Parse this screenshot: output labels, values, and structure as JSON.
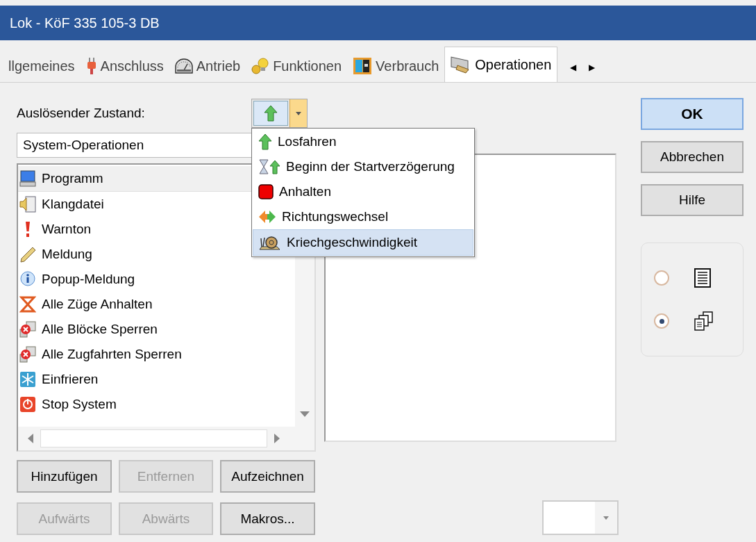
{
  "window": {
    "title": "Lok - KöF 335 105-3 DB"
  },
  "tabs": [
    {
      "label": "llgemeines",
      "selected": false
    },
    {
      "label": "Anschluss",
      "selected": false
    },
    {
      "label": "Antrieb",
      "selected": false
    },
    {
      "label": "Funktionen",
      "selected": false
    },
    {
      "label": "Verbrauch",
      "selected": false
    },
    {
      "label": "Operationen",
      "selected": true
    }
  ],
  "tab_scroll": [
    "◀",
    "▶"
  ],
  "trigger": {
    "label": "Auslösender Zustand:"
  },
  "trigger_menu": {
    "items": [
      {
        "label": "Losfahren",
        "selected": false
      },
      {
        "label": "Beginn der Startverzögerung",
        "selected": false
      },
      {
        "label": "Anhalten",
        "selected": false
      },
      {
        "label": "Richtungswechsel",
        "selected": false
      },
      {
        "label": "Kriechgeschwindigkeit",
        "selected": true
      }
    ]
  },
  "category": {
    "value": "System-Operationen"
  },
  "operations": {
    "items": [
      {
        "label": "Programm",
        "selected": true
      },
      {
        "label": "Klangdatei",
        "selected": false
      },
      {
        "label": "Warnton",
        "selected": false
      },
      {
        "label": "Meldung",
        "selected": false
      },
      {
        "label": "Popup-Meldung",
        "selected": false
      },
      {
        "label": "Alle Züge Anhalten",
        "selected": false
      },
      {
        "label": "Alle Blöcke Sperren",
        "selected": false
      },
      {
        "label": "Alle Zugfahrten Sperren",
        "selected": false
      },
      {
        "label": "Einfrieren",
        "selected": false
      },
      {
        "label": "Stop System",
        "selected": false
      }
    ]
  },
  "buttons": [
    {
      "label": "Hinzufügen",
      "disabled": false
    },
    {
      "label": "Entfernen",
      "disabled": true
    },
    {
      "label": "Aufzeichnen",
      "disabled": false
    },
    {
      "label": "Aufwärts",
      "disabled": true
    },
    {
      "label": "Abwärts",
      "disabled": true
    },
    {
      "label": "Makros...",
      "disabled": false
    }
  ],
  "dialog_buttons": [
    {
      "label": "OK",
      "default": true
    },
    {
      "label": "Abbrechen",
      "default": false
    },
    {
      "label": "Hilfe",
      "default": false
    }
  ],
  "view_options": [
    {
      "selected": false
    },
    {
      "selected": true
    }
  ],
  "macro_select": {
    "disabled": true
  }
}
